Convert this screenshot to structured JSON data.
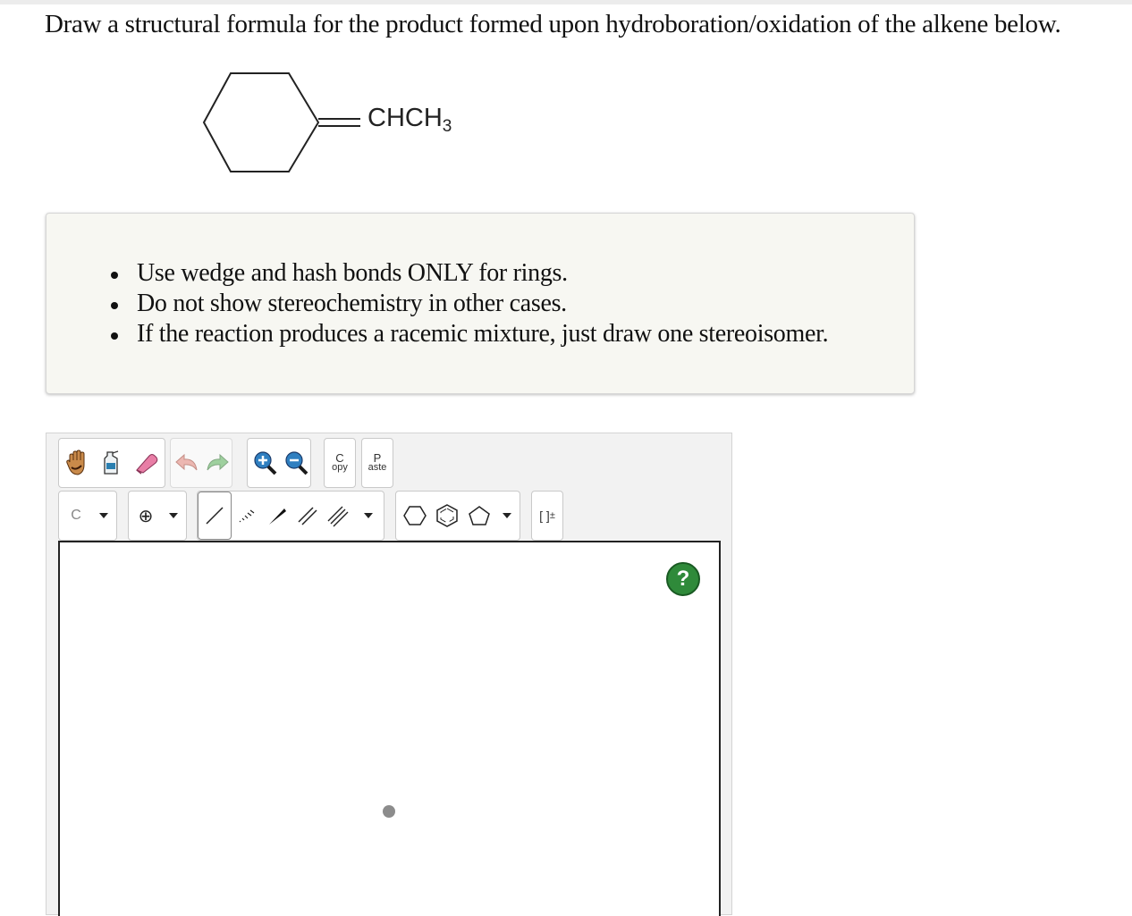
{
  "question": {
    "text": "Draw a structural formula for the product formed upon hydroboration/oxidation of the alkene below."
  },
  "molecule": {
    "substituent": "CHCH",
    "subscript": "3"
  },
  "instructions": {
    "items": [
      "Use wedge and hash bonds ONLY for rings.",
      "Do not show stereochemistry in other cases.",
      "If the reaction produces a racemic mixture, just draw one stereoisomer."
    ]
  },
  "toolbar": {
    "copy_top": "C",
    "copy_bottom": "opy",
    "paste_top": "P",
    "paste_bottom": "aste",
    "atom_label": "C",
    "charge_label": "⊕",
    "bracket_label": "[ ]",
    "bracket_sup": "±",
    "icons": [
      "hand-icon",
      "eraser-bottle-icon",
      "eraser-icon",
      "undo-icon",
      "redo-icon",
      "zoom-in-icon",
      "zoom-out-icon"
    ]
  },
  "canvas": {
    "help_label": "?"
  },
  "colors": {
    "help_green": "#2f8a3a",
    "eraser_pink": "#e87ea6",
    "redo_green": "#5bb55b"
  }
}
